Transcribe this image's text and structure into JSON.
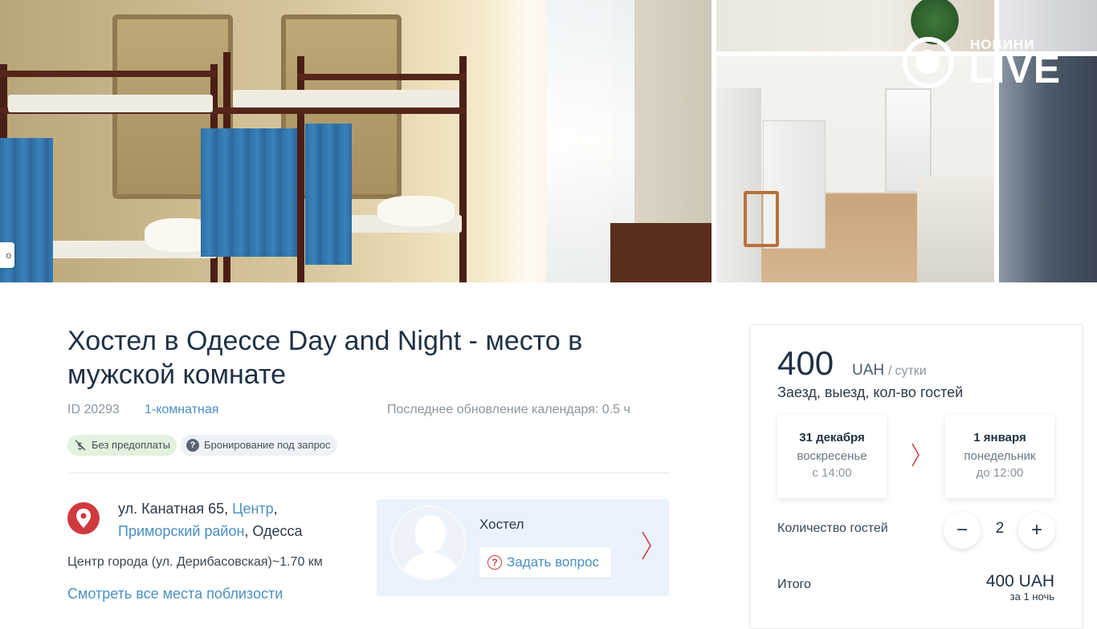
{
  "gallery": {
    "more_button_label": "о"
  },
  "watermark": {
    "top_text": "НОВИНИ",
    "main_text": "LIVE"
  },
  "listing": {
    "title": "Хостел в Одессе Day and Night - место в мужской комнате",
    "id_text": "ID 20293",
    "rooms": "1-комнатная",
    "calendar_update": "Последнее обновление календаря: 0.5 ч",
    "badges": [
      {
        "label": "Без предоплаты",
        "icon": "no-prepayment-icon"
      },
      {
        "label": "Бронирование под запрос",
        "icon": "question-icon"
      }
    ]
  },
  "location": {
    "street": "ул. Канатная 65, ",
    "district_center": "Центр",
    "comma": ",",
    "district": "Приморский район",
    "city": ", Одесса",
    "center_distance": "Центр города (ул. Дерибасовская)~1.70 км",
    "nearby_link": "Смотреть все места поблизости"
  },
  "host": {
    "name": "Хостел",
    "ask_button": "Задать вопрос"
  },
  "booking": {
    "price": "400",
    "currency": "UAH",
    "slash": "/",
    "per": "сутки",
    "dates_label": "Заезд, выезд, кол-во гостей",
    "checkin": {
      "date": "31 декабря",
      "weekday": "воскресенье",
      "time": "с 14:00"
    },
    "checkout": {
      "date": "1 января",
      "weekday": "понедельник",
      "time": "до 12:00"
    },
    "guests_label": "Количество гостей",
    "guests_minus": "−",
    "guests_value": "2",
    "guests_plus": "+",
    "total_label": "Итого",
    "total_value": "400 UAH",
    "total_note": "за 1 ночь"
  },
  "colors": {
    "accent_blue": "#4a8fc4",
    "accent_red": "#d03a3e",
    "title_dark": "#1e3144"
  }
}
